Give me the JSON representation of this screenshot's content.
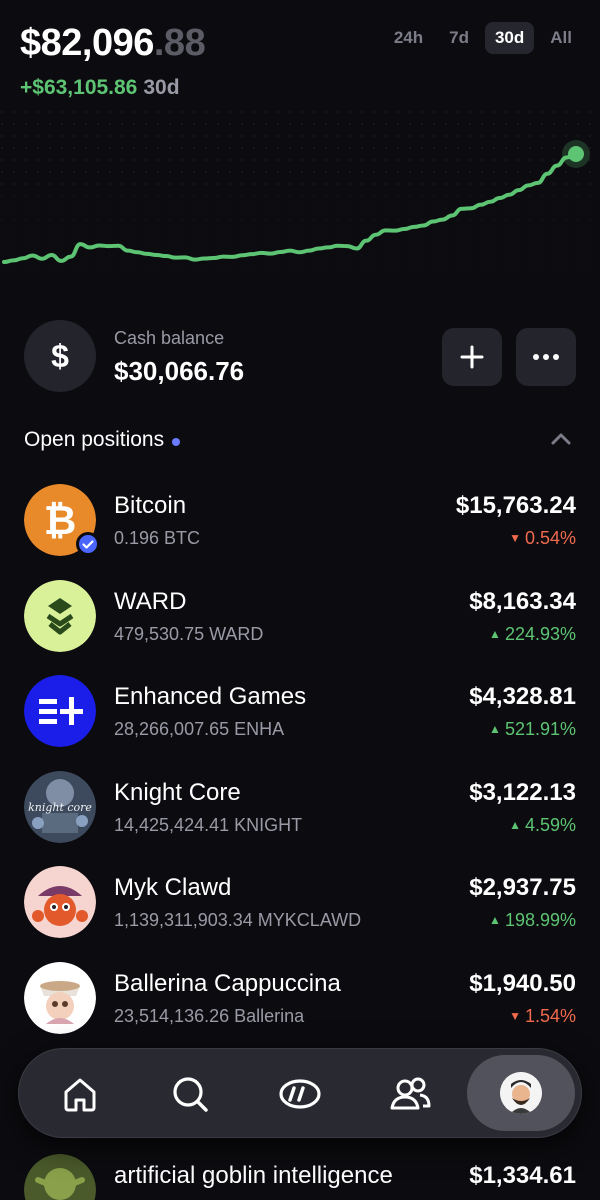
{
  "portfolio": {
    "balance_main": "$82,096",
    "balance_cents": ".88",
    "pnl_amount": "+$63,105.86",
    "pnl_period": "30d",
    "ranges": [
      "24h",
      "7d",
      "30d",
      "All"
    ],
    "active_range": "30d"
  },
  "cash": {
    "icon": "dollar-icon",
    "label": "Cash balance",
    "value": "$30,066.76"
  },
  "positions_header": {
    "title": "Open positions"
  },
  "positions": [
    {
      "name": "Bitcoin",
      "amount": "0.196 BTC",
      "value": "$15,763.24",
      "change": "0.54%",
      "direction": "down"
    },
    {
      "name": "WARD",
      "amount": "479,530.75 WARD",
      "value": "$8,163.34",
      "change": "224.93%",
      "direction": "up"
    },
    {
      "name": "Enhanced Games",
      "amount": "28,266,007.65 ENHA",
      "value": "$4,328.81",
      "change": "521.91%",
      "direction": "up"
    },
    {
      "name": "Knight Core",
      "amount": "14,425,424.41 KNIGHT",
      "value": "$3,122.13",
      "change": "4.59%",
      "direction": "up"
    },
    {
      "name": "Myk Clawd",
      "amount": "1,139,311,903.34 MYKCLAWD",
      "value": "$2,937.75",
      "change": "198.99%",
      "direction": "up"
    },
    {
      "name": "Ballerina Cappuccina",
      "amount": "23,514,136.26 Ballerina",
      "value": "$1,940.50",
      "change": "1.54%",
      "direction": "down"
    }
  ],
  "peek_position": {
    "name": "artificial goblin intelligence",
    "value": "$1,334.61"
  },
  "avatars": {
    "knight_core_text": "knight core"
  },
  "nav": {
    "items": [
      "home-icon",
      "search-icon",
      "swap-icon",
      "people-icon",
      "profile-avatar"
    ]
  },
  "chart_data": {
    "type": "line",
    "title": "",
    "xlabel": "",
    "ylabel": "",
    "x": [
      0,
      1,
      2,
      3,
      4,
      5,
      6,
      7,
      8,
      9,
      10,
      11,
      12,
      13,
      14,
      15,
      16,
      17,
      18,
      19,
      20,
      21,
      22,
      23,
      24,
      25,
      26,
      27,
      28,
      29,
      30,
      31,
      32,
      33,
      34,
      35,
      36,
      37,
      38,
      39,
      40,
      41,
      42,
      43,
      44,
      45,
      46,
      47,
      48,
      49,
      50,
      51,
      52,
      53,
      54,
      55,
      56,
      57,
      58,
      59,
      60
    ],
    "values": [
      18200,
      18800,
      19600,
      20600,
      19400,
      20800,
      18600,
      20200,
      24800,
      23600,
      24300,
      24100,
      24200,
      22400,
      21800,
      21200,
      20800,
      20400,
      19800,
      19900,
      19100,
      19500,
      19700,
      20200,
      20100,
      20700,
      21100,
      21600,
      21300,
      21900,
      22400,
      21800,
      22400,
      23200,
      23600,
      24200,
      24100,
      23200,
      26100,
      28300,
      29900,
      29800,
      30400,
      31200,
      31700,
      33200,
      33900,
      35400,
      37900,
      38100,
      39400,
      40500,
      41900,
      43100,
      44800,
      46600,
      47500,
      50900,
      53900,
      56900,
      58200
    ],
    "color": "#5dc473",
    "grid": false
  },
  "colors": {
    "background": "#0c0c10",
    "positive": "#5dc473",
    "negative": "#f06a4e",
    "accent_dot": "#6b7cff",
    "surface": "#24242c"
  }
}
